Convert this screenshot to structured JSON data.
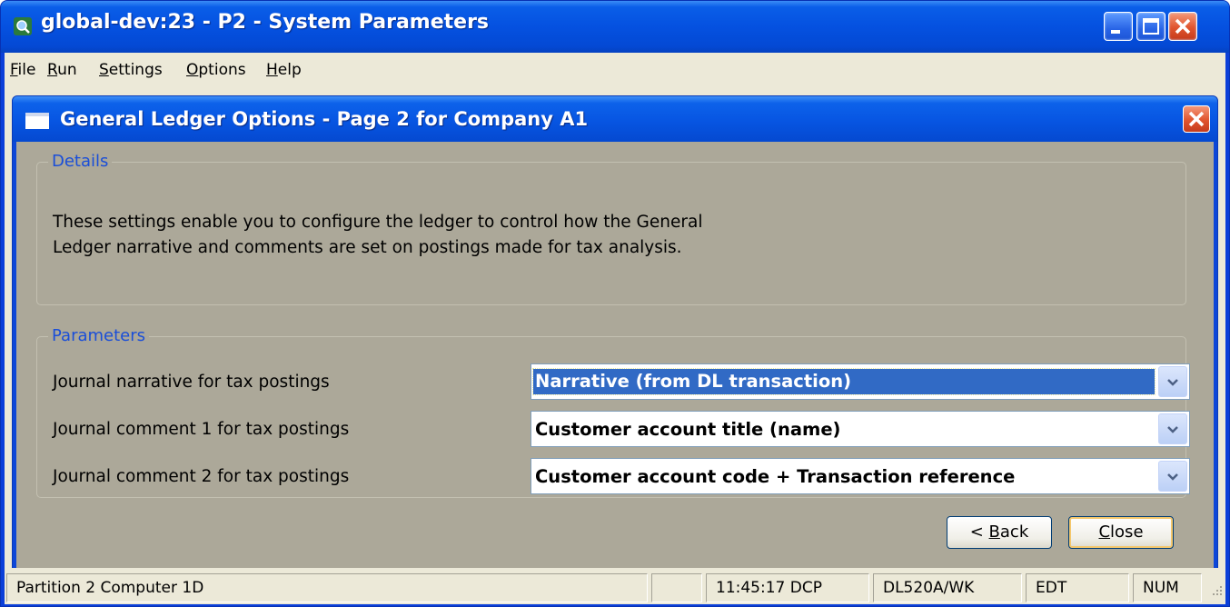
{
  "window": {
    "title": "global-dev:23 - P2 - System Parameters"
  },
  "menu": [
    {
      "prefix": "",
      "mnemonic": "F",
      "rest": "ile"
    },
    {
      "prefix": "",
      "mnemonic": "R",
      "rest": "un"
    },
    {
      "prefix": "",
      "mnemonic": "S",
      "rest": "ettings"
    },
    {
      "prefix": "",
      "mnemonic": "O",
      "rest": "ptions"
    },
    {
      "prefix": "",
      "mnemonic": "H",
      "rest": "elp"
    }
  ],
  "dialog": {
    "title": "General Ledger Options - Page 2 for Company A1",
    "details": {
      "label": "Details",
      "line1": "These settings enable you to configure the ledger to control how the General",
      "line2": "Ledger narrative and comments are set on postings made for tax analysis."
    },
    "parameters": {
      "label": "Parameters",
      "rows": [
        {
          "label": "Journal narrative for tax postings",
          "value": "Narrative (from DL transaction)"
        },
        {
          "label": "Journal comment 1 for tax postings",
          "value": "Customer account title (name)"
        },
        {
          "label": "Journal comment 2 for tax postings",
          "value": "Customer account code + Transaction reference"
        }
      ]
    },
    "buttons": {
      "back_prefix": "< ",
      "back_mnemonic": "B",
      "back_rest": "ack",
      "close_mnemonic": "C",
      "close_rest": "lose"
    }
  },
  "statusbar": {
    "partition": "Partition 2 Computer 1D",
    "blank": "",
    "time": "11:45:17",
    "user": "DCP",
    "program": "DL520A/WK",
    "mode": "EDT",
    "numlock": "NUM"
  },
  "colors": {
    "titlebar": "#0551e0",
    "face": "#ece9d8",
    "dialog_body": "#aca899",
    "group_label": "#1a4ed8",
    "selection": "#316ac5"
  }
}
